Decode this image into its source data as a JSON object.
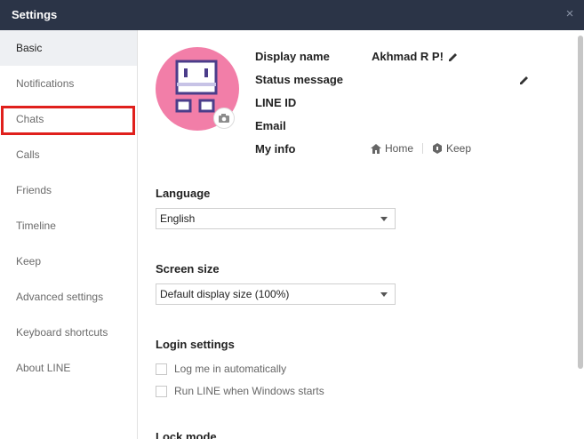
{
  "window": {
    "title": "Settings",
    "close_glyph": "×"
  },
  "sidebar": {
    "items": [
      {
        "label": "Basic"
      },
      {
        "label": "Notifications"
      },
      {
        "label": "Chats"
      },
      {
        "label": "Calls"
      },
      {
        "label": "Friends"
      },
      {
        "label": "Timeline"
      },
      {
        "label": "Keep"
      },
      {
        "label": "Advanced settings"
      },
      {
        "label": "Keyboard shortcuts"
      },
      {
        "label": "About LINE"
      }
    ]
  },
  "profile": {
    "display_name_label": "Display name",
    "display_name_value": "Akhmad R P!",
    "status_message_label": "Status message",
    "line_id_label": "LINE ID",
    "email_label": "Email",
    "my_info_label": "My info",
    "home_link": "Home",
    "keep_link": "Keep",
    "avatar_color": "#f27ea8"
  },
  "language": {
    "title": "Language",
    "selected": "English"
  },
  "screen_size": {
    "title": "Screen size",
    "selected": "Default display size (100%)"
  },
  "login_settings": {
    "title": "Login settings",
    "options": [
      {
        "label": "Log me in automatically",
        "checked": false
      },
      {
        "label": "Run LINE when Windows starts",
        "checked": false
      }
    ]
  },
  "lock_mode": {
    "title": "Lock mode"
  },
  "colors": {
    "titlebar": "#2b3447",
    "highlight": "#e0201c"
  }
}
